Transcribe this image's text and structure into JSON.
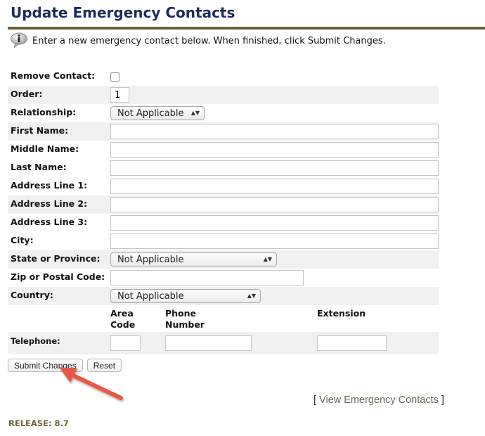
{
  "page": {
    "title": "Update Emergency Contacts",
    "info_icon": "info-speech-bubble-icon",
    "info_text": "Enter a new emergency contact below. When finished, click Submit Changes."
  },
  "form": {
    "remove_contact": {
      "label": "Remove Contact:",
      "checked": false
    },
    "order": {
      "label": "Order:",
      "value": "1"
    },
    "relationship": {
      "label": "Relationship:",
      "selected": "Not Applicable"
    },
    "first_name": {
      "label": "First Name:",
      "value": ""
    },
    "middle_name": {
      "label": "Middle Name:",
      "value": ""
    },
    "last_name": {
      "label": "Last Name:",
      "value": ""
    },
    "address1": {
      "label": "Address Line 1:",
      "value": ""
    },
    "address2": {
      "label": "Address Line 2:",
      "value": ""
    },
    "address3": {
      "label": "Address Line 3:",
      "value": ""
    },
    "city": {
      "label": "City:",
      "value": ""
    },
    "state": {
      "label": "State or Province:",
      "selected": "Not Applicable"
    },
    "zip": {
      "label": "Zip or Postal Code:",
      "value": ""
    },
    "country": {
      "label": "Country:",
      "selected": "Not Applicable"
    },
    "telephone": {
      "label": "Telephone:",
      "area_code_header_1": "Area",
      "area_code_header_2": "Code",
      "phone_header_1": "Phone",
      "phone_header_2": "Number",
      "extension_header": "Extension",
      "area_code": "",
      "phone_number": "",
      "extension": ""
    }
  },
  "buttons": {
    "submit": "Submit Changes",
    "reset": "Reset"
  },
  "annotation": {
    "arrow_color": "#e8594a",
    "points_to": "Submit Changes"
  },
  "links": {
    "open_bracket": "[",
    "view_contacts": "View Emergency Contacts",
    "close_bracket": "]"
  },
  "footer": {
    "release": "RELEASE: 8.7"
  },
  "colors": {
    "title": "#1a2e5c",
    "rule": "#6b6338",
    "row_alt": "#f1f1f1",
    "release": "#6b6338"
  }
}
